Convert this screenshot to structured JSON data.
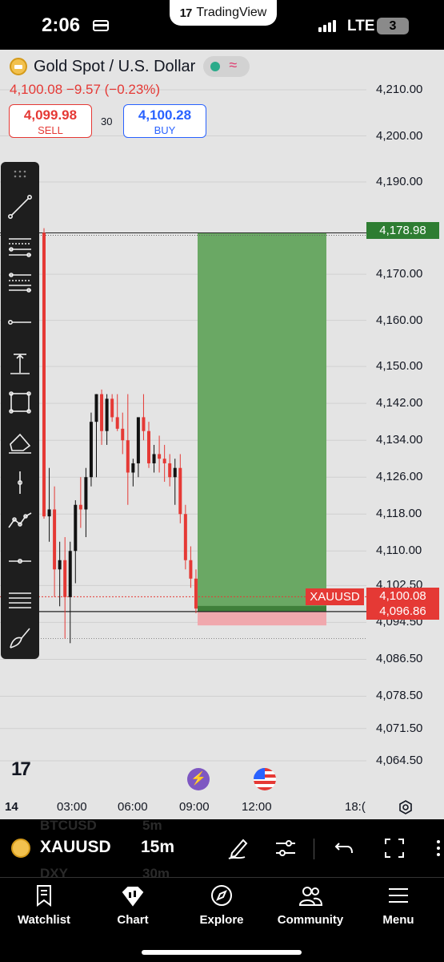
{
  "status_bar": {
    "time": "2:06",
    "pill_logo": "17",
    "pill_text": "TradingView",
    "network": "LTE",
    "battery": "3"
  },
  "header": {
    "title": "Gold Spot / U.S. Dollar",
    "quote": "4,100.08  −9.57 (−0.23%)",
    "sell_price": "4,099.98",
    "sell_label": "SELL",
    "spread": "30",
    "buy_price": "4,100.28",
    "buy_label": "BUY"
  },
  "toolbar_icons": [
    "drag-handle-icon",
    "trend-line-icon",
    "fib-retracement-icon",
    "fib-extension-icon",
    "horizontal-ray-icon",
    "vertical-measure-icon",
    "rectangle-icon",
    "brush-icon",
    "vertical-line-icon",
    "patterns-icon",
    "price-line-icon",
    "parallel-channel-icon",
    "pen-icon"
  ],
  "price_axis": {
    "labels": [
      {
        "text": "4,210.00",
        "value": 4210.0
      },
      {
        "text": "4,200.00",
        "value": 4200.0
      },
      {
        "text": "4,190.00",
        "value": 4190.0
      },
      {
        "text": "4,170.00",
        "value": 4170.0
      },
      {
        "text": "4,160.00",
        "value": 4160.0
      },
      {
        "text": "4,150.00",
        "value": 4150.0
      },
      {
        "text": "4,142.00",
        "value": 4142.0
      },
      {
        "text": "4,134.00",
        "value": 4134.0
      },
      {
        "text": "4,126.00",
        "value": 4126.0
      },
      {
        "text": "4,118.00",
        "value": 4118.0
      },
      {
        "text": "4,110.00",
        "value": 4110.0
      },
      {
        "text": "4,102.50",
        "value": 4102.5
      },
      {
        "text": "4,094.50",
        "value": 4094.5
      },
      {
        "text": "4,086.50",
        "value": 4086.5
      },
      {
        "text": "4,078.50",
        "value": 4078.5
      },
      {
        "text": "4,071.50",
        "value": 4071.5
      },
      {
        "text": "4,064.50",
        "value": 4064.5
      }
    ],
    "target_tag": "4,178.98",
    "symbol_tag": "XAUUSD",
    "last_tag": "4,100.08",
    "entry_tag": "4,096.86"
  },
  "time_axis": {
    "labels": [
      "14",
      "03:00",
      "06:00",
      "09:00",
      "12:00",
      "18:("
    ]
  },
  "chart_data": {
    "type": "candlestick",
    "symbol": "XAUUSD",
    "interval": "15m",
    "colors": {
      "up": "#111111",
      "down": "#e53935",
      "target_zone": "#6aa864",
      "stop_zone": "#f0a8ad"
    },
    "position": {
      "type": "long",
      "entry": 4096.86,
      "target": 4178.98,
      "stop": 4094.9
    },
    "candles": [
      {
        "o": 4179.0,
        "h": 4180.0,
        "l": 4117.0,
        "c": 4117.5
      },
      {
        "o": 4117.5,
        "h": 4128.0,
        "l": 4112.0,
        "c": 4119.0
      },
      {
        "o": 4119.0,
        "h": 4124.0,
        "l": 4100.0,
        "c": 4106.0
      },
      {
        "o": 4106.0,
        "h": 4112.0,
        "l": 4098.0,
        "c": 4108.0
      },
      {
        "o": 4108.0,
        "h": 4113.0,
        "l": 4091.0,
        "c": 4100.0
      },
      {
        "o": 4100.0,
        "h": 4112.0,
        "l": 4090.0,
        "c": 4110.0
      },
      {
        "o": 4110.0,
        "h": 4121.0,
        "l": 4103.0,
        "c": 4120.0
      },
      {
        "o": 4120.0,
        "h": 4126.0,
        "l": 4115.0,
        "c": 4119.0
      },
      {
        "o": 4119.0,
        "h": 4128.0,
        "l": 4113.0,
        "c": 4126.0
      },
      {
        "o": 4126.0,
        "h": 4140.0,
        "l": 4124.0,
        "c": 4138.0
      },
      {
        "o": 4138.0,
        "h": 4144.0,
        "l": 4126.0,
        "c": 4144.0
      },
      {
        "o": 4144.0,
        "h": 4145.0,
        "l": 4133.0,
        "c": 4136.0
      },
      {
        "o": 4136.0,
        "h": 4144.0,
        "l": 4133.0,
        "c": 4143.0
      },
      {
        "o": 4143.0,
        "h": 4144.0,
        "l": 4138.0,
        "c": 4139.0
      },
      {
        "o": 4139.0,
        "h": 4144.0,
        "l": 4136.0,
        "c": 4136.5
      },
      {
        "o": 4136.5,
        "h": 4140.0,
        "l": 4131.0,
        "c": 4134.0
      },
      {
        "o": 4134.0,
        "h": 4144.0,
        "l": 4120.0,
        "c": 4127.0
      },
      {
        "o": 4127.0,
        "h": 4130.0,
        "l": 4124.0,
        "c": 4129.0
      },
      {
        "o": 4129.0,
        "h": 4137.0,
        "l": 4126.0,
        "c": 4139.0
      },
      {
        "o": 4139.0,
        "h": 4144.0,
        "l": 4134.0,
        "c": 4136.0
      },
      {
        "o": 4136.0,
        "h": 4138.0,
        "l": 4128.0,
        "c": 4129.0
      },
      {
        "o": 4129.0,
        "h": 4133.0,
        "l": 4127.0,
        "c": 4131.0
      },
      {
        "o": 4131.0,
        "h": 4135.0,
        "l": 4127.0,
        "c": 4130.0
      },
      {
        "o": 4130.0,
        "h": 4133.0,
        "l": 4125.0,
        "c": 4129.0
      },
      {
        "o": 4129.0,
        "h": 4131.0,
        "l": 4124.0,
        "c": 4126.0
      },
      {
        "o": 4126.0,
        "h": 4130.0,
        "l": 4120.0,
        "c": 4128.0
      },
      {
        "o": 4128.0,
        "h": 4131.0,
        "l": 4116.0,
        "c": 4118.0
      },
      {
        "o": 4118.0,
        "h": 4120.0,
        "l": 4106.0,
        "c": 4108.0
      },
      {
        "o": 4108.0,
        "h": 4111.0,
        "l": 4102.0,
        "c": 4104.0
      },
      {
        "o": 4104.0,
        "h": 4106.0,
        "l": 4096.5,
        "c": 4097.5
      }
    ]
  },
  "events": {
    "bolt_icon": "lightning-icon",
    "flag_icon": "us-flag-icon"
  },
  "symbol_bar": {
    "symbol": "XAUUSD",
    "timeframe": "15m",
    "ghost_top_symbol": "BTCUSD",
    "ghost_top_tf": "5m",
    "ghost_bottom_symbol": "DXY",
    "ghost_bottom_tf": "30m"
  },
  "nav": {
    "items": [
      {
        "label": "Watchlist",
        "icon": "bookmark-icon"
      },
      {
        "label": "Chart",
        "icon": "chart-candles-icon"
      },
      {
        "label": "Explore",
        "icon": "compass-icon"
      },
      {
        "label": "Community",
        "icon": "people-icon"
      },
      {
        "label": "Menu",
        "icon": "hamburger-icon"
      }
    ]
  }
}
